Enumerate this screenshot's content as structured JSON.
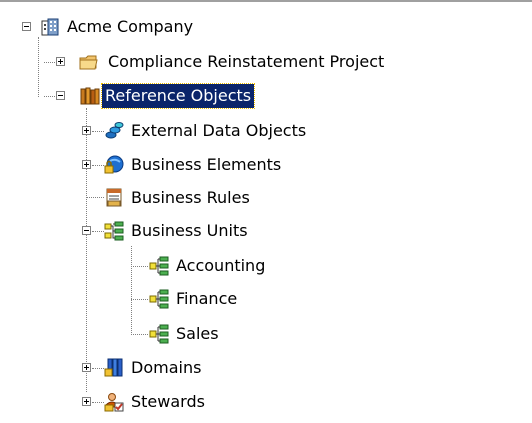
{
  "tree": {
    "root": {
      "label": "Acme Company",
      "icon": "company-building-icon",
      "expanded": true
    },
    "items": [
      {
        "id": "compliance",
        "label": "Compliance Reinstatement Project",
        "icon": "folder-icon",
        "expanded": false
      },
      {
        "id": "reference",
        "label": "Reference Objects",
        "icon": "books-icon",
        "expanded": true,
        "selected": true
      },
      {
        "id": "external",
        "label": "External Data Objects",
        "icon": "database-cylinders-icon",
        "expanded": false
      },
      {
        "id": "elements",
        "label": "Business Elements",
        "icon": "globe-lock-icon",
        "expanded": false
      },
      {
        "id": "rules",
        "label": "Business Rules",
        "icon": "rules-document-icon"
      },
      {
        "id": "units",
        "label": "Business Units",
        "icon": "org-chart-icon",
        "expanded": true
      },
      {
        "id": "accounting",
        "label": "Accounting",
        "icon": "org-unit-icon"
      },
      {
        "id": "finance",
        "label": "Finance",
        "icon": "org-unit-icon"
      },
      {
        "id": "sales",
        "label": "Sales",
        "icon": "org-unit-icon"
      },
      {
        "id": "domains",
        "label": "Domains",
        "icon": "domains-columns-icon",
        "expanded": false
      },
      {
        "id": "stewards",
        "label": "Stewards",
        "icon": "stewards-people-icon",
        "expanded": false
      }
    ]
  },
  "colors": {
    "selection_bg": "#0a246a",
    "selection_text": "#ffffff"
  }
}
